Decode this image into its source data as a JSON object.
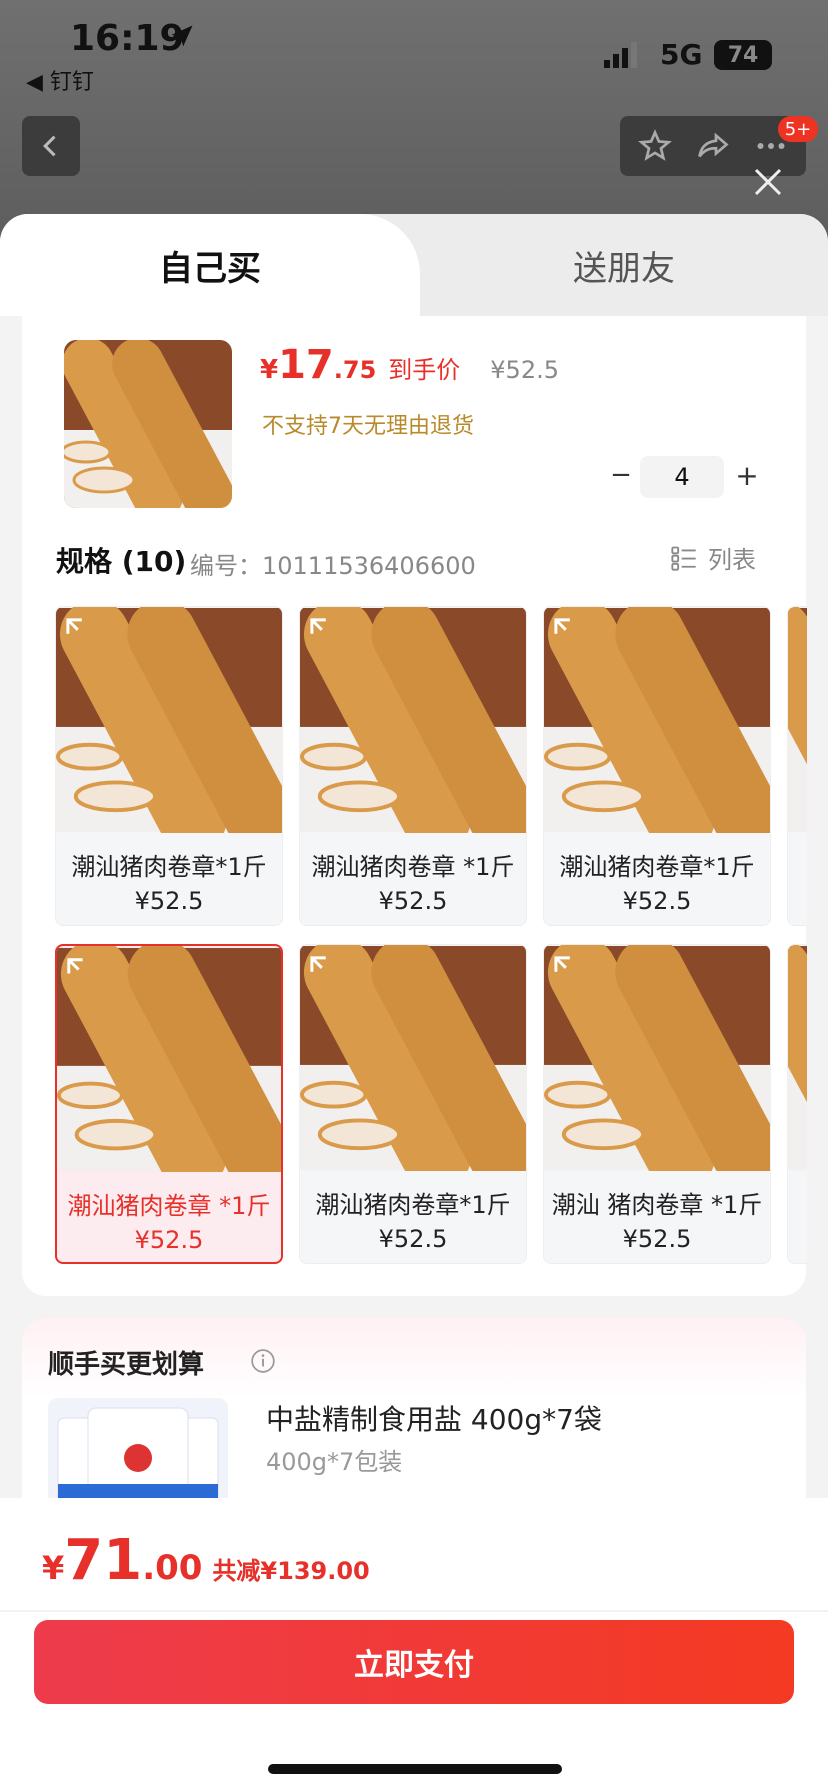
{
  "status_bar": {
    "time": "16:19",
    "back_app": "◀ 钉钉",
    "network": "5G",
    "battery": "74"
  },
  "nav": {
    "badge": "5+"
  },
  "tabs": [
    {
      "label": "自己买",
      "active": true
    },
    {
      "label": "送朋友",
      "active": false
    }
  ],
  "product": {
    "currency": "¥",
    "price_int": "17",
    "price_dec": ".75",
    "price_label": "到手价",
    "original_price": "¥52.5",
    "return_note": "不支持7天无理由退货",
    "quantity": "4",
    "minus": "−",
    "plus": "+"
  },
  "spec": {
    "title": "规格 (10)",
    "id_text": "编号：10111536406600",
    "list_label": "列表"
  },
  "variants": [
    {
      "label": "潮汕猪肉卷章*1斤 ¥52.5",
      "selected": false
    },
    {
      "label": "潮汕猪肉卷章 *1斤 ¥52.5",
      "selected": false
    },
    {
      "label": "潮汕猪肉卷章*1斤 ¥52.5",
      "selected": false
    },
    {
      "label": "潮汕猪肉卷章 *1斤 ¥52.5",
      "selected": true
    },
    {
      "label": "潮汕猪肉卷章*1斤 ¥52.5",
      "selected": false
    },
    {
      "label": "潮汕 猪肉卷章 *1斤 ¥52.5",
      "selected": false
    }
  ],
  "addon": {
    "title": "顺手买更划算",
    "name": "中盐精制食用盐 400g*7袋",
    "spec": "400g*7包装"
  },
  "checkout": {
    "currency": "¥",
    "total_int": "71",
    "total_dec": ".00",
    "saving": "共减¥139.00",
    "pay_label": "立即支付"
  },
  "colors": {
    "accent": "#e8302a",
    "gold": "#b88a2a"
  }
}
